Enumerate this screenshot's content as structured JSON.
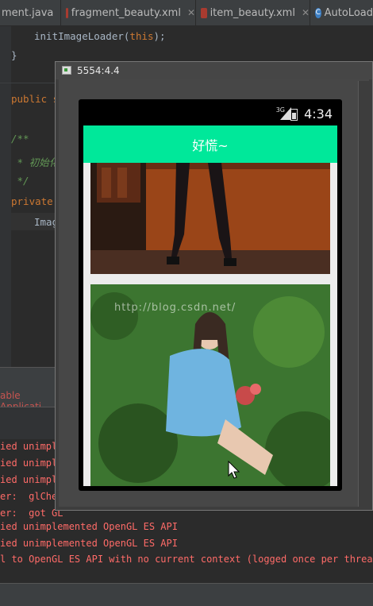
{
  "tabs": [
    {
      "label": "ment.java",
      "icon": "java-file-icon"
    },
    {
      "label": "fragment_beauty.xml",
      "icon": "xml-file-icon"
    },
    {
      "label": "item_beauty.xml",
      "icon": "xml-file-icon"
    },
    {
      "label": "AutoLoad",
      "icon": "class-icon"
    }
  ],
  "editor": {
    "line1": "initImageLoader(",
    "line1_this": "this",
    "line1_end": ");",
    "line2": "}",
    "line3_kw": "public s",
    "line4": "/**",
    "line5": " * 初始化",
    "line6": " */",
    "line7_kw": "private",
    "line8": "Imag"
  },
  "run_panel": {
    "tab_label": "able Applicati"
  },
  "log_lines": [
    "ied unimple",
    "ied unimple",
    "ied unimple",
    "er:  glChec",
    "er:  got GL",
    "ied unimplemented OpenGL ES API",
    "ied unimplemented OpenGL ES API",
    "l to OpenGL ES API with no current context (logged once per thread)"
  ],
  "emulator": {
    "window_title": "5554:4.4",
    "status_bar": {
      "network": "3G",
      "time": "4:34"
    },
    "action_bar_title": "好慌~",
    "watermark": "http://blog.csdn.net/"
  },
  "colors": {
    "accent": "#00e89a",
    "ide_bg": "#2b2b2b",
    "log_red": "#ff6b68"
  }
}
